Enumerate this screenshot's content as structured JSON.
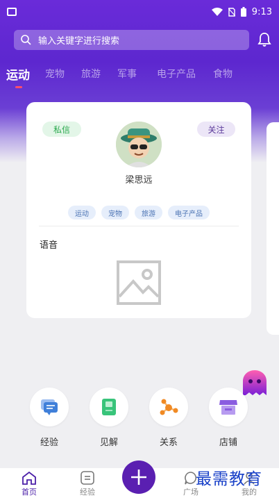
{
  "status_bar": {
    "time": "9:13"
  },
  "search": {
    "placeholder": "输入关键字进行搜索"
  },
  "tabs": [
    {
      "label": "运动",
      "active": true
    },
    {
      "label": "宠物"
    },
    {
      "label": "旅游"
    },
    {
      "label": "军事"
    },
    {
      "label": "电子产品"
    },
    {
      "label": "食物"
    }
  ],
  "card": {
    "message_label": "私信",
    "follow_label": "关注",
    "username": "梁思远",
    "tags": [
      "运动",
      "宠物",
      "旅游",
      "电子产品"
    ],
    "voice_label": "语音"
  },
  "quick_actions": [
    {
      "label": "经验",
      "icon": "chat-bubble-icon",
      "color": "#3f7fd9"
    },
    {
      "label": "见解",
      "icon": "book-icon",
      "color": "#38c47a"
    },
    {
      "label": "关系",
      "icon": "network-icon",
      "color": "#f08a24"
    },
    {
      "label": "店铺",
      "icon": "shop-icon",
      "color": "#8a5ce0"
    }
  ],
  "bottom_nav": [
    {
      "label": "首页",
      "icon": "home-icon",
      "active": true
    },
    {
      "label": "经验",
      "icon": "list-icon"
    },
    {
      "label": "广场",
      "icon": "message-icon"
    },
    {
      "label": "我的",
      "icon": "profile-icon"
    }
  ],
  "watermark": "最需教育",
  "colors": {
    "accent": "#5a1fb1",
    "active_tab_indicator": "#ff4d6d"
  }
}
